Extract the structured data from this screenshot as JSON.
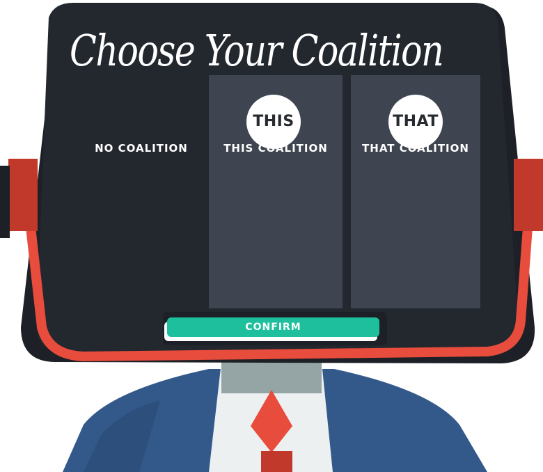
{
  "screen": {
    "title": "Choose Your Coalition"
  },
  "options": [
    {
      "badge": "",
      "label": "NO COALITION"
    },
    {
      "badge": "THIS",
      "label": "THIS COALITION"
    },
    {
      "badge": "THAT",
      "label": "THAT COALITION"
    }
  ],
  "confirm_label": "CONFIRM",
  "colors": {
    "screen_bg": "#23272e",
    "panel": "#3e4550",
    "frame_red": "#e74c3c",
    "dark_red": "#c0392b",
    "accent_green": "#1dbf9d",
    "suit_blue": "#33598a",
    "shirt": "#ecf0f1",
    "neck": "#95a5a6"
  }
}
